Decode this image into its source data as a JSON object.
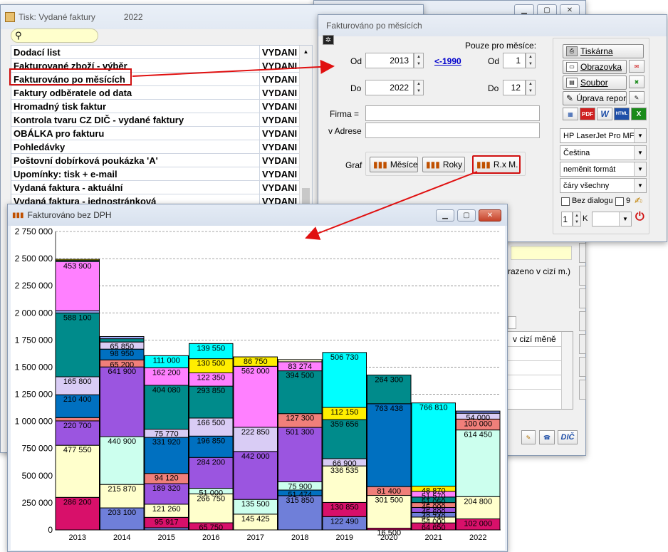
{
  "tisk_window": {
    "title": "Tisk: Vydané faktury",
    "year": "2022",
    "col2_header": "VYDANI",
    "rows": [
      {
        "name": "Dodací list",
        "type": "VYDANI"
      },
      {
        "name": "Fakturované zboží - výběr",
        "type": "VYDANI"
      },
      {
        "name": "Fakturováno po měsících",
        "type": "VYDANI"
      },
      {
        "name": "Faktury odběratele od data",
        "type": "VYDANI"
      },
      {
        "name": "Hromadný tisk faktur",
        "type": "VYDANI"
      },
      {
        "name": "Kontrola tvaru CZ DIČ - vydané faktury",
        "type": "VYDANI"
      },
      {
        "name": "OBÁLKA pro fakturu",
        "type": "VYDANI"
      },
      {
        "name": "Pohledávky",
        "type": "VYDANI"
      },
      {
        "name": "Poštovní dobírková poukázka  'A'",
        "type": "VYDANI"
      },
      {
        "name": "Upomínky: tisk + e-mail",
        "type": "VYDANI"
      },
      {
        "name": "Vydaná faktura - aktuální",
        "type": "VYDANI"
      },
      {
        "name": "Vydaná faktura - jednostránková",
        "type": "VYDANI"
      }
    ]
  },
  "back_window": {
    "note_text": "razeno v cizí m.)",
    "col_header": "v cizí měně",
    "dic_label": "DIČ"
  },
  "dialog": {
    "title": "Fakturováno po měsících",
    "pouze_label": "Pouze pro měsíce:",
    "od_label": "Od",
    "do_label": "Do",
    "od_year": "2013",
    "do_year": "2022",
    "link_1990": "<-1990",
    "od_month": "1",
    "do_month": "12",
    "firma_label": "Firma =",
    "adrese_label": "v Adrese",
    "firma_value": "",
    "adrese_value": "",
    "graf_label": "Graf",
    "btn_mesice": "Měsíce",
    "btn_roky": "Roky",
    "btn_rxm": "R.x M.",
    "btn_tiskarna": "Tiskárna",
    "btn_obrazovka": "Obrazovka",
    "btn_soubor": "Soubor",
    "btn_uprava": "Úprava repor",
    "printer": "HP LaserJet Pro MFP",
    "language": "Čeština",
    "format": "neměnit formát",
    "lines": "čáry všechny",
    "bez_dialogu": "Bez dialogu",
    "copies_label": "9",
    "copies": "1",
    "k_label": "K",
    "fmt_icons": [
      "PDF",
      "W",
      "HTML",
      "X"
    ]
  },
  "chart_window": {
    "title": "Fakturováno bez DPH"
  },
  "chart_data": {
    "type": "bar",
    "stacked": true,
    "title": "",
    "xlabel": "",
    "ylabel": "",
    "ylim": [
      0,
      2750000
    ],
    "yticks": [
      "0",
      "250 000",
      "500 000",
      "750 000",
      "1 000 000",
      "1 250 000",
      "1 500 000",
      "1 750 000",
      "2 000 000",
      "2 250 000",
      "2 500 000",
      "2 750 000"
    ],
    "grid": true,
    "categories": [
      "2013",
      "2014",
      "2015",
      "2016",
      "2017",
      "2018",
      "2019",
      "2020",
      "2021",
      "2022"
    ],
    "bars": [
      {
        "year": "2013",
        "segments": [
          {
            "v": 0,
            "c": "#6f7fd9",
            "l": ""
          },
          {
            "v": 300000,
            "c": "#d8106a",
            "l": "286 200"
          },
          {
            "v": 480000,
            "c": "#ffffcc",
            "l": "477 550"
          },
          {
            "v": 225000,
            "c": "#9b55e0",
            "l": "220 700"
          },
          {
            "v": 30000,
            "c": "#f07f7a",
            "l": ""
          },
          {
            "v": 210400,
            "c": "#0070c0",
            "l": "210 400"
          },
          {
            "v": 165800,
            "c": "#d9ccf5",
            "l": "165 800"
          },
          {
            "v": 588100,
            "c": "#008b8b",
            "l": "588 100"
          },
          {
            "v": 20000,
            "c": "#a0b0ff",
            "l": ""
          },
          {
            "v": 453900,
            "c": "#ff80ff",
            "l": "453 900"
          },
          {
            "v": 10000,
            "c": "#00b0b0",
            "l": ""
          },
          {
            "v": 10000,
            "c": "#ffee00",
            "l": ""
          }
        ]
      },
      {
        "year": "2014",
        "segments": [
          {
            "v": 203100,
            "c": "#6f7fd9",
            "l": "203 100"
          },
          {
            "v": 215870,
            "c": "#ffffcc",
            "l": "215 870"
          },
          {
            "v": 440900,
            "c": "#ccffee",
            "l": "440 900"
          },
          {
            "v": 641900,
            "c": "#9b55e0",
            "l": "641 900"
          },
          {
            "v": 65200,
            "c": "#f07f7a",
            "l": "65 200"
          },
          {
            "v": 98950,
            "c": "#0070c0",
            "l": "98 950"
          },
          {
            "v": 65850,
            "c": "#d9ccf5",
            "l": "65 850"
          },
          {
            "v": 30000,
            "c": "#008b8b",
            "l": ""
          },
          {
            "v": 20000,
            "c": "#a0b0ff",
            "l": ""
          }
        ]
      },
      {
        "year": "2015",
        "segments": [
          {
            "v": 20000,
            "c": "#6f7fd9",
            "l": ""
          },
          {
            "v": 95917,
            "c": "#d8106a",
            "l": "95 917"
          },
          {
            "v": 121260,
            "c": "#ffffcc",
            "l": "121 260"
          },
          {
            "v": 189320,
            "c": "#9b55e0",
            "l": "189 320"
          },
          {
            "v": 94120,
            "c": "#f07f7a",
            "l": "94 120"
          },
          {
            "v": 331920,
            "c": "#0070c0",
            "l": "331 920"
          },
          {
            "v": 75770,
            "c": "#d9ccf5",
            "l": "75 770"
          },
          {
            "v": 404080,
            "c": "#008b8b",
            "l": "404 080"
          },
          {
            "v": 162200,
            "c": "#ff80ff",
            "l": "162 200"
          },
          {
            "v": 111000,
            "c": "#00ffff",
            "l": "111 000"
          }
        ]
      },
      {
        "year": "2016",
        "segments": [
          {
            "v": 65750,
            "c": "#d8106a",
            "l": "65 750"
          },
          {
            "v": 266750,
            "c": "#ffffcc",
            "l": "266 750"
          },
          {
            "v": 51000,
            "c": "#ccffee",
            "l": "51 000"
          },
          {
            "v": 284200,
            "c": "#9b55e0",
            "l": "284 200"
          },
          {
            "v": 196850,
            "c": "#0070c0",
            "l": "196 850"
          },
          {
            "v": 166500,
            "c": "#d9ccf5",
            "l": "166 500"
          },
          {
            "v": 293850,
            "c": "#008b8b",
            "l": "293 850"
          },
          {
            "v": 122350,
            "c": "#ff80ff",
            "l": "122 350"
          },
          {
            "v": 130500,
            "c": "#ffee00",
            "l": "130 500"
          },
          {
            "v": 139550,
            "c": "#00ffff",
            "l": "139 550"
          }
        ]
      },
      {
        "year": "2017",
        "segments": [
          {
            "v": 145425,
            "c": "#ffffcc",
            "l": "145 425"
          },
          {
            "v": 135500,
            "c": "#ccffee",
            "l": "135 500"
          },
          {
            "v": 442000,
            "c": "#9b55e0",
            "l": "442 000"
          },
          {
            "v": 222850,
            "c": "#d9ccf5",
            "l": "222 850"
          },
          {
            "v": 562000,
            "c": "#ff80ff",
            "l": "562 000"
          },
          {
            "v": 86750,
            "c": "#ffee00",
            "l": "86 750"
          }
        ]
      },
      {
        "year": "2018",
        "segments": [
          {
            "v": 315850,
            "c": "#6f7fd9",
            "l": "315 850"
          },
          {
            "v": 51474,
            "c": "#0070c0",
            "l": "51 474"
          },
          {
            "v": 75900,
            "c": "#ccffee",
            "l": "75 900"
          },
          {
            "v": 501300,
            "c": "#9b55e0",
            "l": "501 300"
          },
          {
            "v": 127300,
            "c": "#f07f7a",
            "l": "127 300"
          },
          {
            "v": 394500,
            "c": "#008b8b",
            "l": "394 500"
          },
          {
            "v": 83274,
            "c": "#ff80ff",
            "l": "83 274"
          },
          {
            "v": 20000,
            "c": "#ffffcc",
            "l": ""
          }
        ]
      },
      {
        "year": "2019",
        "segments": [
          {
            "v": 122490,
            "c": "#6f7fd9",
            "l": "122 490"
          },
          {
            "v": 130850,
            "c": "#d8106a",
            "l": "130 850"
          },
          {
            "v": 336535,
            "c": "#ffffcc",
            "l": "336 535"
          },
          {
            "v": 66900,
            "c": "#d9ccf5",
            "l": "66 900"
          },
          {
            "v": 359656,
            "c": "#008b8b",
            "l": "359 656"
          },
          {
            "v": 112150,
            "c": "#ffee00",
            "l": "112 150"
          },
          {
            "v": 506730,
            "c": "#00ffff",
            "l": "506 730"
          }
        ]
      },
      {
        "year": "2020",
        "segments": [
          {
            "v": 16500,
            "c": "#d8106a",
            "l": "16 500"
          },
          {
            "v": 301500,
            "c": "#ffffcc",
            "l": "301 500"
          },
          {
            "v": 81400,
            "c": "#f07f7a",
            "l": "81 400"
          },
          {
            "v": 763438,
            "c": "#0070c0",
            "l": "763 438"
          },
          {
            "v": 264300,
            "c": "#008b8b",
            "l": "264 300"
          }
        ]
      },
      {
        "year": "2021",
        "segments": [
          {
            "v": 64650,
            "c": "#d8106a",
            "l": "64 650"
          },
          {
            "v": 54000,
            "c": "#ffffcc",
            "l": "54 000"
          },
          {
            "v": 42740,
            "c": "#6f7fd9",
            "l": "42 740"
          },
          {
            "v": 45600,
            "c": "#9b55e0",
            "l": "45 600"
          },
          {
            "v": 45000,
            "c": "#f07f7a",
            "l": "45 000"
          },
          {
            "v": 51050,
            "c": "#008b8b",
            "l": "51 050"
          },
          {
            "v": 51570,
            "c": "#ff80ff",
            "l": "51 570"
          },
          {
            "v": 48870,
            "c": "#ffee00",
            "l": "48 870"
          },
          {
            "v": 766810,
            "c": "#00ffff",
            "l": "766 810"
          }
        ]
      },
      {
        "year": "2022",
        "segments": [
          {
            "v": 102000,
            "c": "#d8106a",
            "l": "102 000"
          },
          {
            "v": 204800,
            "c": "#ffffcc",
            "l": "204 800"
          },
          {
            "v": 614450,
            "c": "#ccffee",
            "l": "614 450"
          },
          {
            "v": 100000,
            "c": "#f07f7a",
            "l": "100 000"
          },
          {
            "v": 54000,
            "c": "#d9ccf5",
            "l": "54 000"
          },
          {
            "v": 20000,
            "c": "#6f7fd9",
            "l": ""
          }
        ]
      }
    ]
  }
}
